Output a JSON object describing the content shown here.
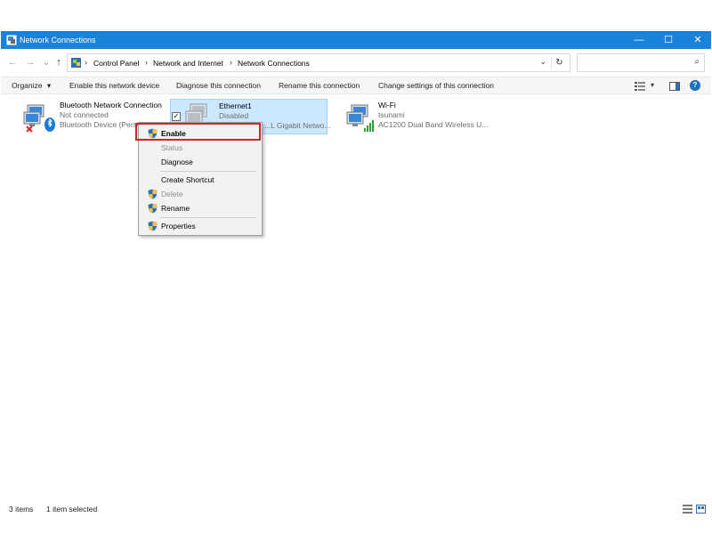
{
  "window": {
    "title": "Network Connections",
    "minimize": "—",
    "maximize": "☐",
    "close": "✕"
  },
  "nav": {
    "back": "←",
    "forward": "→",
    "recent": "⌄",
    "up": "↑"
  },
  "breadcrumb": {
    "items": [
      "Control Panel",
      "Network and Internet",
      "Network Connections"
    ],
    "separator": "›",
    "dropdown": "⌄",
    "refresh": "↻"
  },
  "search": {
    "placeholder": "",
    "icon": "⌕"
  },
  "commands": {
    "organize": "Organize",
    "organize_arrow": "▾",
    "enable": "Enable this network device",
    "diagnose": "Diagnose this connection",
    "rename": "Rename this connection",
    "change": "Change settings of this connection",
    "view_arrow": "▾",
    "help": "?"
  },
  "connections": [
    {
      "name": "Bluetooth Network Connection",
      "status": "Not connected",
      "device": "Bluetooth Device (Person..."
    },
    {
      "name": "Ethernet1",
      "status": "Disabled",
      "device": "...L Gigabit Netwo..."
    },
    {
      "name": "Wi-Fi",
      "status": "tsunami",
      "device": "AC1200  Dual Band Wireless U..."
    }
  ],
  "context_menu": {
    "items": [
      "Enable",
      "Status",
      "Diagnose",
      "Create Shortcut",
      "Delete",
      "Rename",
      "Properties"
    ]
  },
  "status_bar": {
    "count": "3 items",
    "selected": "1 item selected"
  },
  "colors": {
    "titlebar": "#1a82d8",
    "selection": "#cce8ff",
    "highlight": "#d1232a"
  }
}
